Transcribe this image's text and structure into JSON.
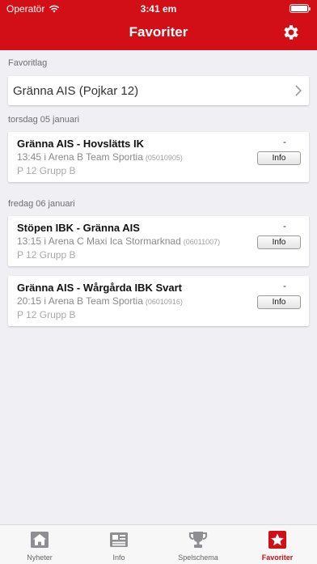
{
  "status_bar": {
    "carrier": "Operatör",
    "time": "3:41 em"
  },
  "header": {
    "title": "Favoriter"
  },
  "favorites": {
    "section_label": "Favoritlag",
    "team_name": "Gränna AIS (Pojkar 12)"
  },
  "days": [
    {
      "label": "torsdag 05 januari",
      "games": [
        {
          "matchup": "Gränna AIS - Hovslätts IK",
          "time_place": "13:45 i Arena B Team Sportia",
          "code": "(05010905)",
          "group": "P 12 Grupp B",
          "score": "-",
          "button": "Info"
        }
      ]
    },
    {
      "label": "fredag 06 januari",
      "games": [
        {
          "matchup": "Stöpen IBK - Gränna AIS",
          "time_place": "13:15 i Arena C Maxi Ica Stormarknad",
          "code": "(06011007)",
          "group": "P 12 Grupp B",
          "score": "-",
          "button": "Info"
        },
        {
          "matchup": "Gränna AIS - Wårgårda IBK Svart",
          "time_place": "20:15 i Arena B Team Sportia",
          "code": "(06010916)",
          "group": "P 12 Grupp B",
          "score": "-",
          "button": "Info"
        }
      ]
    }
  ],
  "tabs": [
    {
      "label": "Nyheter",
      "icon": "house-icon"
    },
    {
      "label": "Info",
      "icon": "newspaper-icon"
    },
    {
      "label": "Spelschema",
      "icon": "trophy-icon"
    },
    {
      "label": "Favoriter",
      "icon": "star-icon",
      "active": true
    }
  ],
  "colors": {
    "brand_red": "#d20f16",
    "background": "#efeff4"
  }
}
